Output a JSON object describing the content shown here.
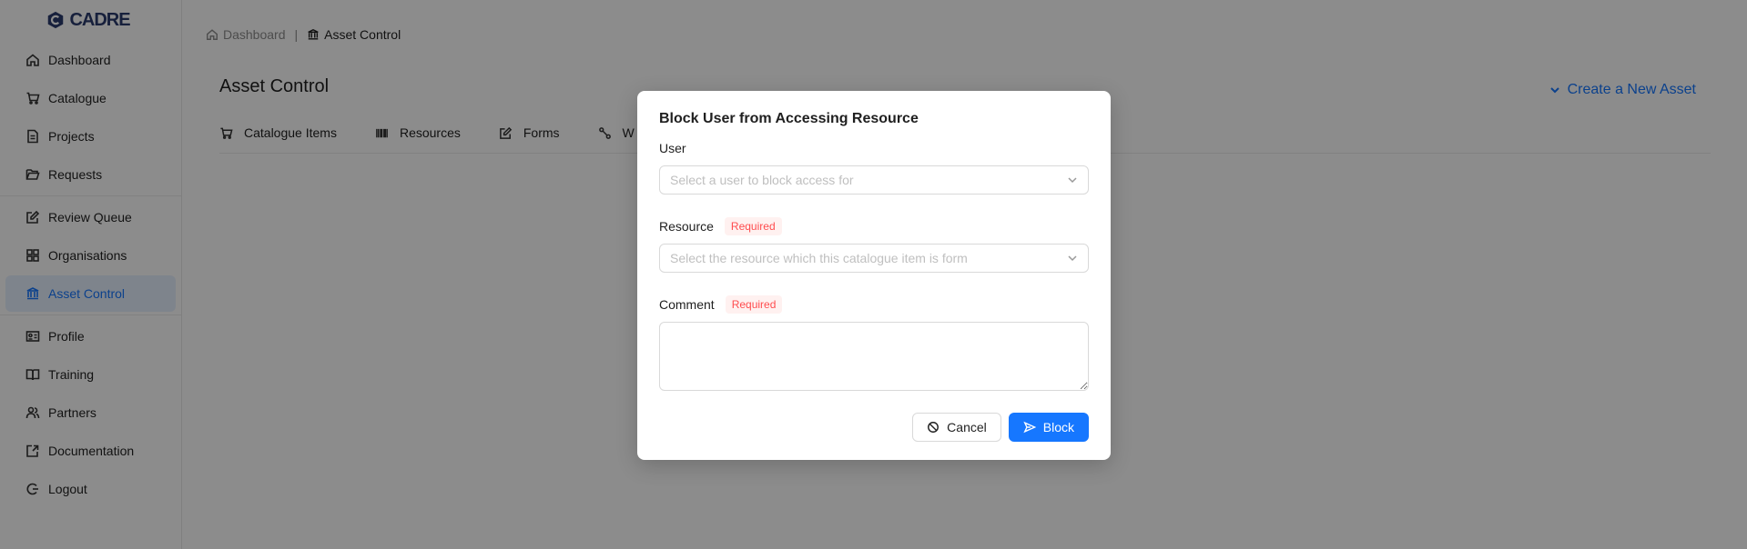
{
  "app": {
    "logo_text": "CADRE"
  },
  "sidebar": {
    "items": [
      {
        "label": "Dashboard",
        "icon": "home-icon"
      },
      {
        "label": "Catalogue",
        "icon": "cart-icon"
      },
      {
        "label": "Projects",
        "icon": "file-icon"
      },
      {
        "label": "Requests",
        "icon": "folder-open-icon"
      },
      {
        "label": "Review Queue",
        "icon": "edit-icon"
      },
      {
        "label": "Organisations",
        "icon": "grid-icon"
      },
      {
        "label": "Asset Control",
        "icon": "bank-icon",
        "active": true
      },
      {
        "label": "Profile",
        "icon": "id-card-icon"
      },
      {
        "label": "Training",
        "icon": "book-icon"
      },
      {
        "label": "Partners",
        "icon": "team-icon"
      },
      {
        "label": "Documentation",
        "icon": "doc-edit-icon"
      },
      {
        "label": "Logout",
        "icon": "logout-icon"
      }
    ]
  },
  "breadcrumb": {
    "home": "Dashboard",
    "separator": "|",
    "current": "Asset Control"
  },
  "page": {
    "title": "Asset Control",
    "create_label": "Create a New Asset"
  },
  "tabs": [
    {
      "label": "Catalogue Items",
      "icon": "cart-icon"
    },
    {
      "label": "Resources",
      "icon": "barcode-icon"
    },
    {
      "label": "Forms",
      "icon": "form-icon"
    },
    {
      "label": "W",
      "icon": "workflow-icon"
    }
  ],
  "modal": {
    "title": "Block User from Accessing Resource",
    "user_label": "User",
    "user_placeholder": "Select a user to block access for",
    "resource_label": "Resource",
    "resource_placeholder": "Select the resource which this catalogue item is form",
    "comment_label": "Comment",
    "comment_value": "",
    "required_tag": "Required",
    "cancel_label": "Cancel",
    "block_label": "Block"
  },
  "colors": {
    "primary": "#1677ff",
    "required": "#ff4d4f",
    "brand": "#2a3b6e"
  }
}
